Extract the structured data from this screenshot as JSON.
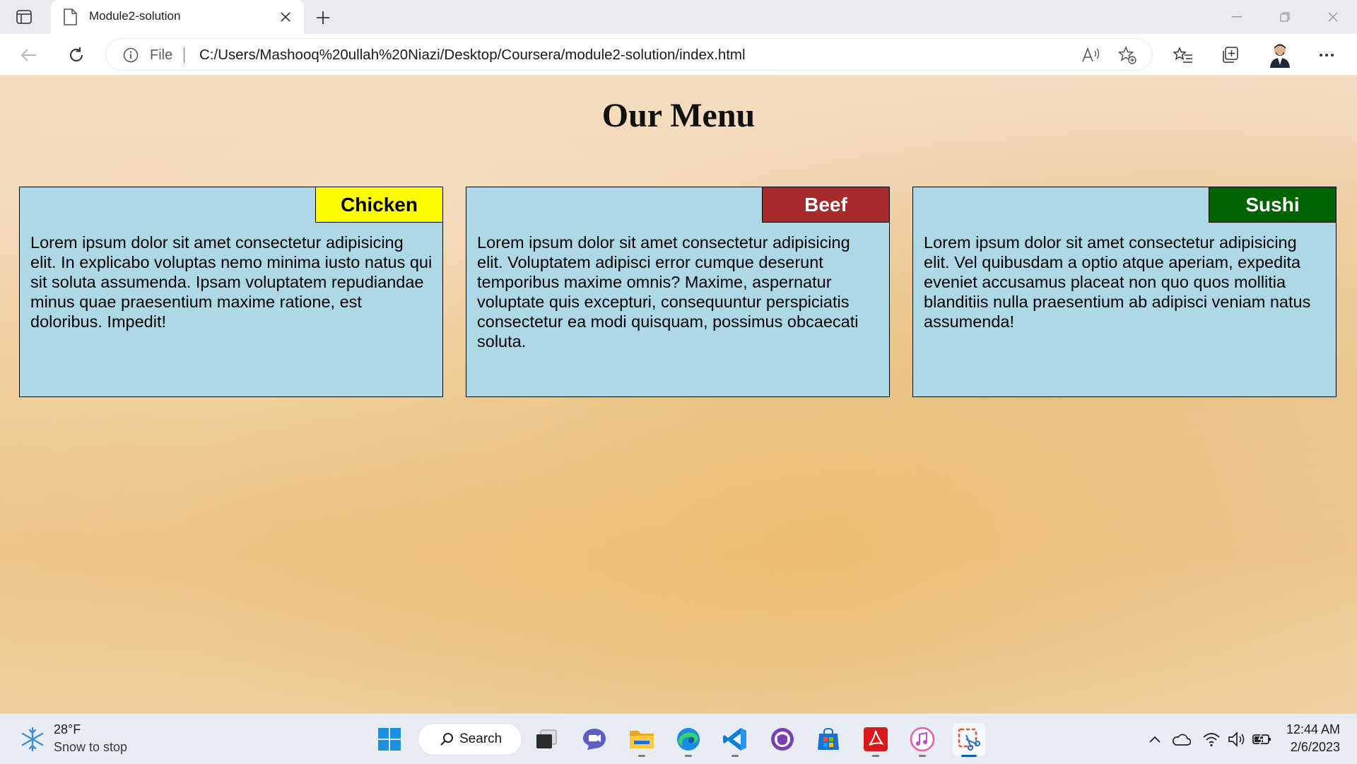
{
  "browser": {
    "tab_title": "Module2-solution",
    "address_scheme": "File",
    "url": "C:/Users/Mashooq%20ullah%20Niazi/Desktop/Coursera/module2-solution/index.html"
  },
  "page": {
    "heading": "Our Menu",
    "cards": [
      {
        "label": "Chicken",
        "label_bg": "#ffff00",
        "label_color": "#000000",
        "text": "Lorem ipsum dolor sit amet consectetur adipisicing elit. In explicabo voluptas nemo minima iusto natus qui sit soluta assumenda. Ipsam voluptatem repudiandae minus quae praesentium maxime ratione, est doloribus. Impedit!"
      },
      {
        "label": "Beef",
        "label_bg": "#a52a2a",
        "label_color": "#ffffff",
        "text": "Lorem ipsum dolor sit amet consectetur adipisicing elit. Voluptatem adipisci error cumque deserunt temporibus maxime omnis? Maxime, aspernatur voluptate quis excepturi, consequuntur perspiciatis consectetur ea modi quisquam, possimus obcaecati soluta."
      },
      {
        "label": "Sushi",
        "label_bg": "#006400",
        "label_color": "#ffffff",
        "text": "Lorem ipsum dolor sit amet consectetur adipisicing elit. Vel quibusdam a optio atque aperiam, expedita eveniet accusamus placeat non quo quos mollitia blanditiis nulla praesentium ab adipisci veniam natus assumenda!"
      }
    ],
    "card_bg": "#add8e6"
  },
  "taskbar": {
    "weather_temp": "28°F",
    "weather_desc": "Snow to stop",
    "search_label": "Search",
    "time": "12:44 AM",
    "date": "2/6/2023",
    "apps": [
      "windows-start",
      "search",
      "task-view",
      "teams-chat",
      "file-explorer",
      "edge",
      "vs-code",
      "github-desktop",
      "microsoft-store",
      "acrobat-reader",
      "itunes",
      "snipping-tool"
    ]
  },
  "colors": {
    "accent": "#0a5fc7"
  }
}
